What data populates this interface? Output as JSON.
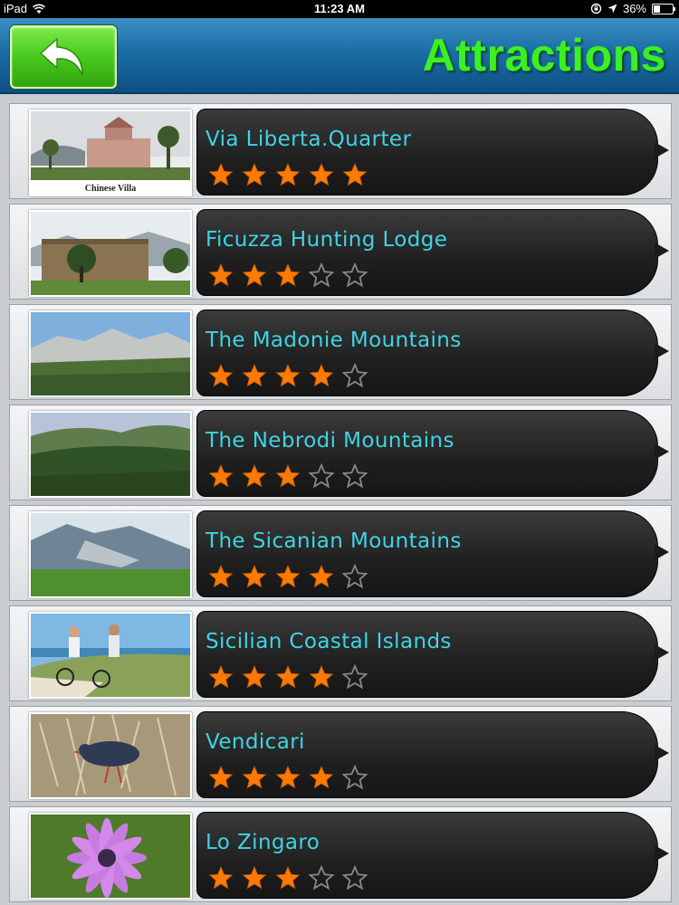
{
  "status_bar": {
    "carrier": "iPad",
    "time": "11:23 AM",
    "battery": "36%",
    "battery_level": 0.36,
    "icons": [
      "wifi-icon",
      "rotation-lock-icon",
      "location-arrow-icon",
      "battery-icon"
    ]
  },
  "header": {
    "title": "Attractions",
    "back_icon": "back-arrow-icon",
    "colors": {
      "bar": "#1b6ea5",
      "title": "#3bf023",
      "back_button": "#49c91e"
    }
  },
  "theme": {
    "row_title_color": "#3fd4e4",
    "star_on": "#ff7a00",
    "star_off": "#888888",
    "bubble": "#222222"
  },
  "attractions": [
    {
      "name": "Via Liberta.Quarter",
      "rating": 5,
      "thumb_caption": "Chinese Villa"
    },
    {
      "name": "Ficuzza Hunting Lodge",
      "rating": 3,
      "thumb_caption": ""
    },
    {
      "name": "The Madonie Mountains",
      "rating": 4,
      "thumb_caption": ""
    },
    {
      "name": "The Nebrodi Mountains",
      "rating": 3,
      "thumb_caption": ""
    },
    {
      "name": "The Sicanian Mountains",
      "rating": 4,
      "thumb_caption": ""
    },
    {
      "name": "Sicilian Coastal Islands",
      "rating": 4,
      "thumb_caption": ""
    },
    {
      "name": "Vendicari",
      "rating": 4,
      "thumb_caption": ""
    },
    {
      "name": "Lo Zingaro",
      "rating": 3,
      "thumb_caption": ""
    }
  ]
}
